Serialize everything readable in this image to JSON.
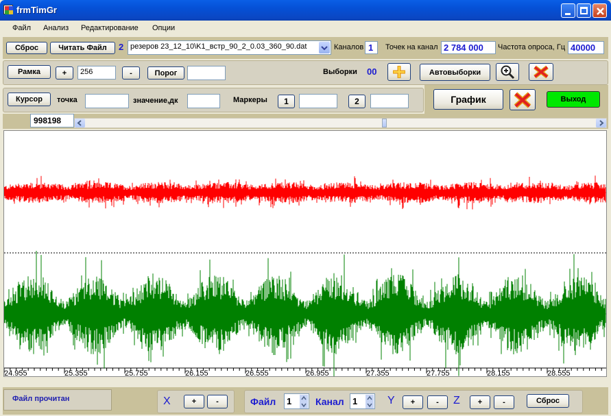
{
  "window": {
    "title": "frmTimGr"
  },
  "menu": {
    "items": [
      "Файл",
      "Анализ",
      "Редактирование",
      "Опции"
    ]
  },
  "row1": {
    "reset_label": "Сброс",
    "read_file_label": "Читать Файл",
    "file_count": "2",
    "file_select_value": "резеров 23_12_10\\K1_встр_90_2_0.03_360_90.dat",
    "channels_label": "Каналов",
    "channels_value": "1",
    "points_label": "Точек на канал",
    "points_value": "2 784 000",
    "rate_label": "Частота опроса, Гц",
    "rate_value": "40000"
  },
  "row2": {
    "frame_label": "Рамка",
    "plus_label": "+",
    "frame_value": "256",
    "minus_label": "-",
    "threshold_label": "Порог",
    "threshold_value": "",
    "samples_label": "Выборки",
    "samples_value": "00",
    "auto_samples_label": "Автовыборки"
  },
  "row3": {
    "cursor_label": "Курсор",
    "point_label": "точка",
    "point_value": "",
    "value_label": "значение,дк",
    "value_value": "",
    "markers_label": "Маркеры",
    "marker1_label": "1",
    "marker1_value": "",
    "marker2_label": "2",
    "marker2_value": "",
    "graph_label": "График",
    "exit_label": "Выход"
  },
  "scroll": {
    "position_value": "998198"
  },
  "plot": {
    "x_ticks": [
      "24.955",
      "25.355",
      "25.755",
      "26.155",
      "26.555",
      "26.955",
      "27.355",
      "27.755",
      "28.155",
      "28.555"
    ],
    "series_colors": [
      "#FF0000",
      "#008000"
    ]
  },
  "bottom": {
    "status_text": "Файл прочитан",
    "x_label": "X",
    "x_plus": "+",
    "x_minus": "-",
    "file_label": "Файл",
    "file_value": "1",
    "channel_label": "Канал",
    "channel_value": "1",
    "y_label": "Y",
    "y_plus": "+",
    "y_minus": "-",
    "z_label": "Z",
    "z_plus": "+",
    "z_minus": "-",
    "reset_label": "Сброс"
  },
  "icons": {
    "add_samples": "plus-cross-icon",
    "zoom": "magnifier-plus-icon",
    "delete": "red-x-icon"
  }
}
